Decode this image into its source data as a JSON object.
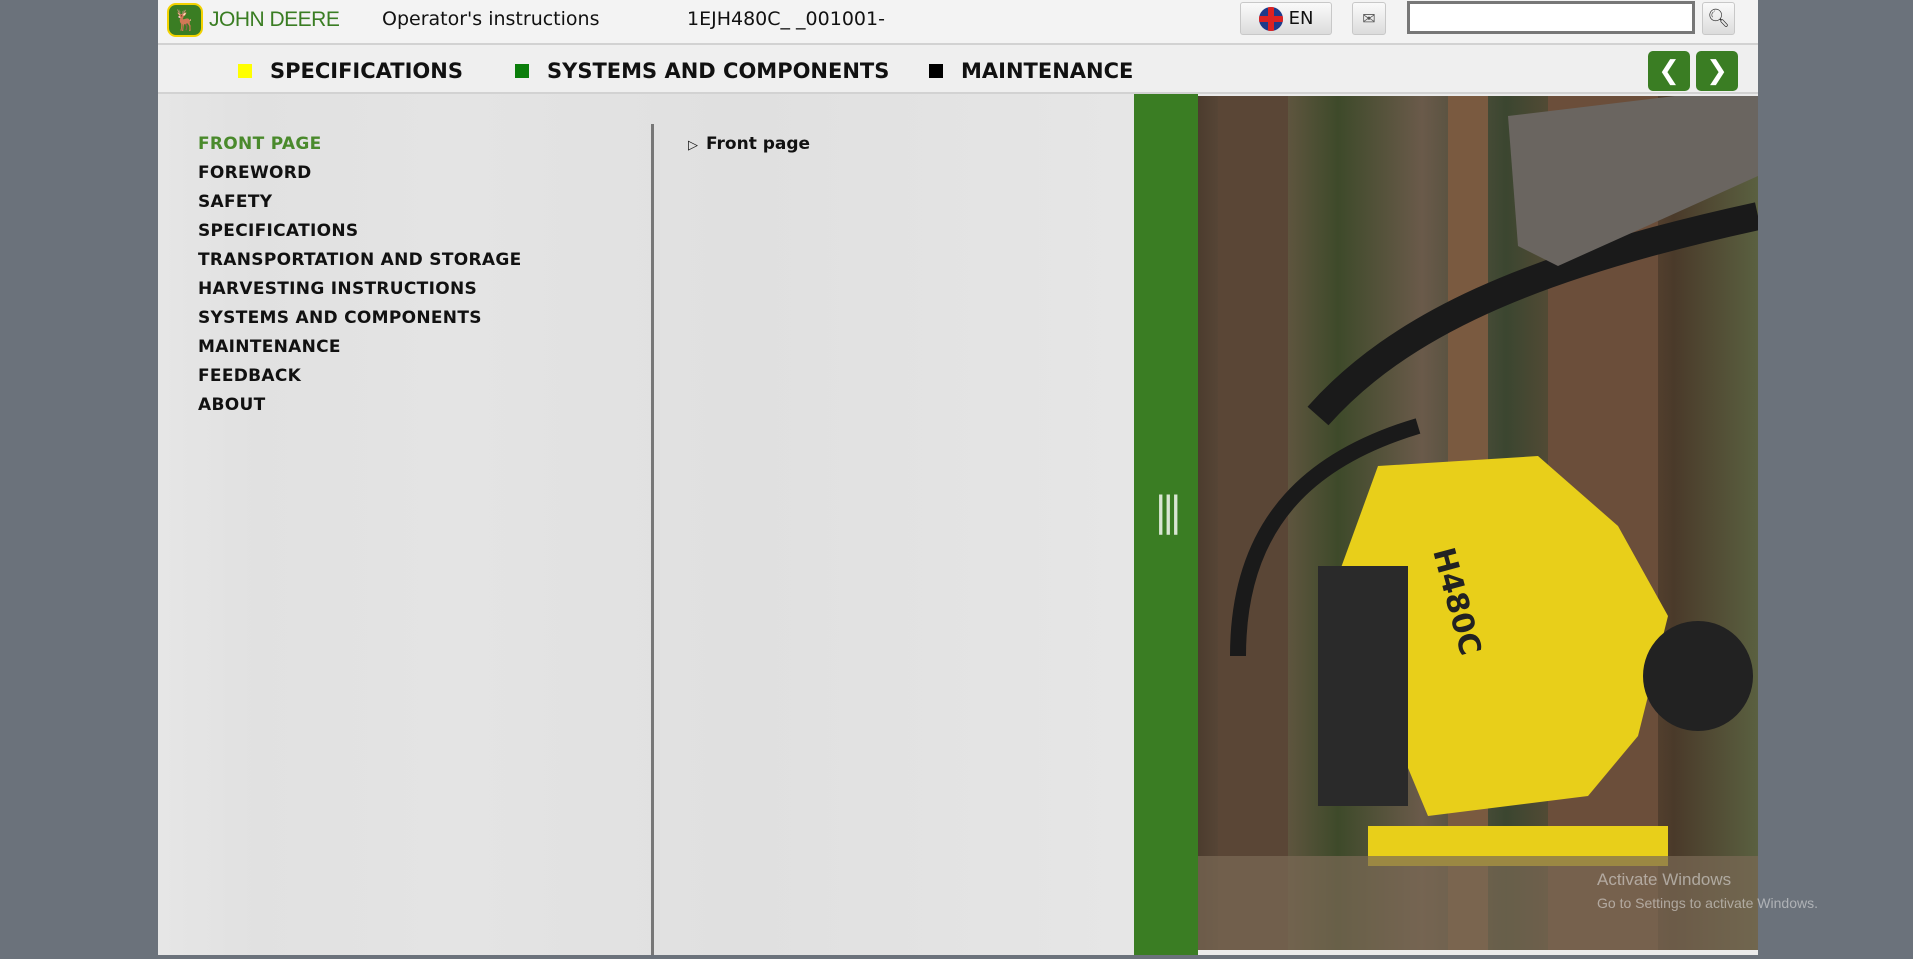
{
  "header": {
    "brand": "JOHN DEERE",
    "title": "Operator's instructions",
    "doc_code": "1EJH480C_ _001001-",
    "language": "EN",
    "search_value": ""
  },
  "nav": {
    "items": [
      {
        "label": "SPECIFICATIONS",
        "color": "#ffff00"
      },
      {
        "label": "SYSTEMS AND COMPONENTS",
        "color": "#0a7d0a"
      },
      {
        "label": "MAINTENANCE",
        "color": "#000000"
      }
    ]
  },
  "toc": {
    "items": [
      "FRONT PAGE",
      "FOREWORD",
      "SAFETY",
      "SPECIFICATIONS",
      "TRANSPORTATION AND STORAGE",
      "HARVESTING INSTRUCTIONS",
      "SYSTEMS AND COMPONENTS",
      "MAINTENANCE",
      "FEEDBACK",
      "ABOUT"
    ],
    "active": "FRONT PAGE"
  },
  "content": {
    "tree_item": "Front page"
  },
  "photo": {
    "model_label": "H480C"
  },
  "watermark": {
    "line1": "Activate Windows",
    "line2": "Go to Settings to activate Windows."
  }
}
